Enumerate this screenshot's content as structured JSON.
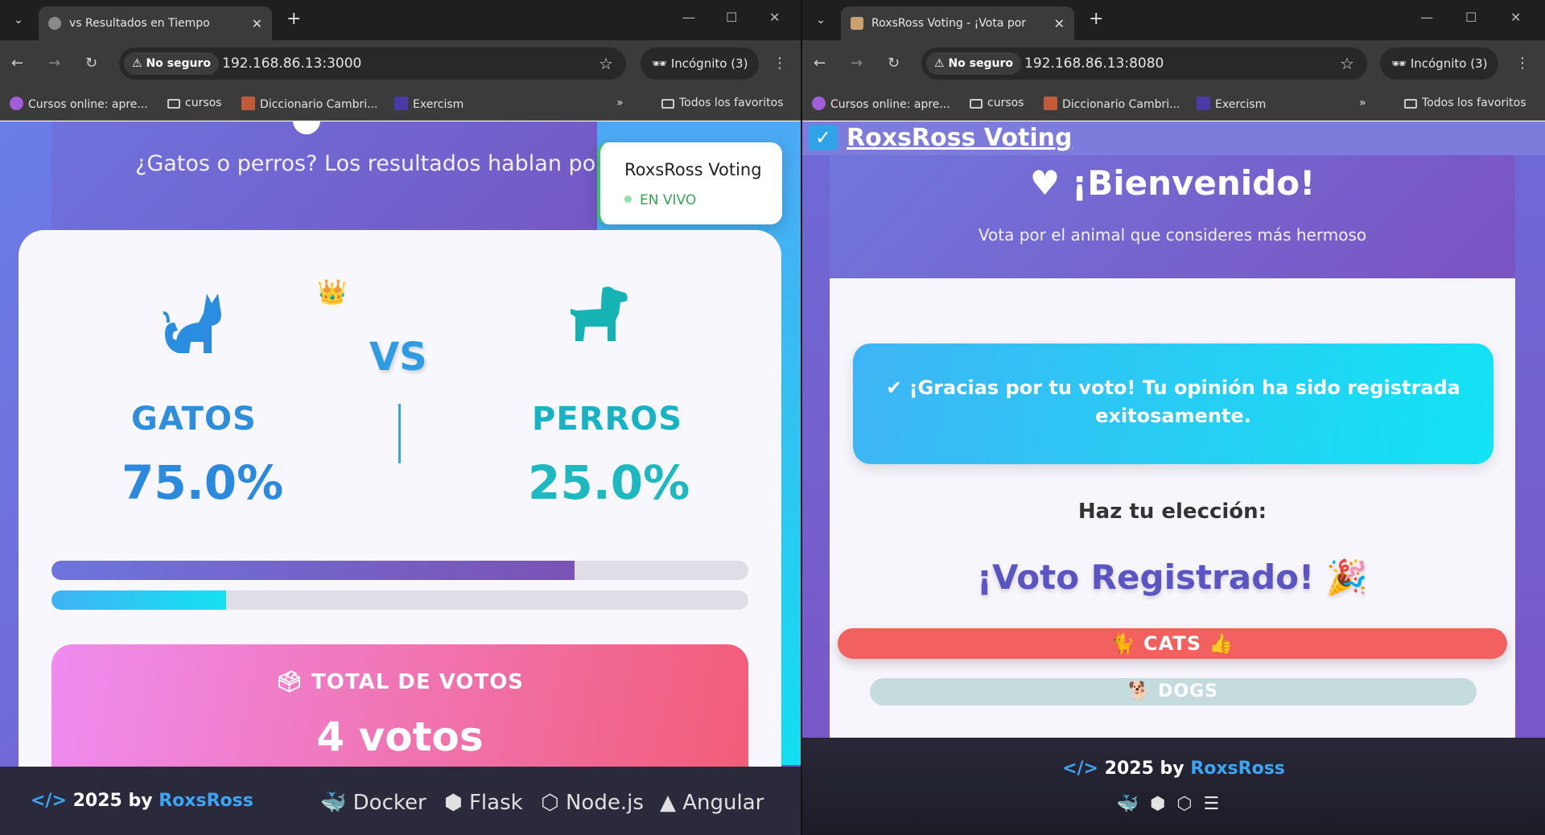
{
  "left": {
    "tab_title": "vs  Resultados en Tiempo",
    "tab_emoji": "🐱 vs 🐶",
    "url": "192.168.86.13:3000",
    "not_secure": "No seguro",
    "incognito": "Incógnito (3)",
    "bookmarks": [
      "Cursos online: apre...",
      "cursos",
      "Diccionario Cambri...",
      "Exercism"
    ],
    "all_bookmarks": "Todos los favoritos",
    "subtitle": "¿Gatos o perros? Los resultados hablan por s",
    "live_title": "RoxsRoss Voting",
    "live_status": "EN VIVO",
    "vs": "VS",
    "cats_label": "GATOS",
    "dogs_label": "PERROS",
    "cats_pct": "75.0%",
    "dogs_pct": "25.0%",
    "cats_share": 0.75,
    "dogs_share": 0.25,
    "total_label": "TOTAL DE VOTOS",
    "total_value": "4 votos",
    "footer_year": "2025 by",
    "footer_brand": "RoxsRoss",
    "tech": [
      "Docker",
      "Flask",
      "Node.js",
      "Angular"
    ]
  },
  "right": {
    "tab_title": "RoxsRoss Voting - ¡Vota por",
    "url": "192.168.86.13:8080",
    "not_secure": "No seguro",
    "incognito": "Incógnito (3)",
    "bookmarks": [
      "Cursos online: apre...",
      "cursos",
      "Diccionario Cambri...",
      "Exercism"
    ],
    "all_bookmarks": "Todos los favoritos",
    "app_title": "RoxsRoss Voting",
    "welcome_title": "¡Bienvenido!",
    "welcome_sub": "Vota por el animal que consideres más hermoso",
    "thanks": "¡Gracias por tu voto! Tu opinión ha sido registrada exitosamente.",
    "choose": "Haz tu elección:",
    "registered": "¡Voto Registrado!",
    "cats_btn": "CATS",
    "dogs_btn": "DOGS",
    "footer_year": "2025 by",
    "footer_brand": "RoxsRoss"
  },
  "colors": {
    "cats_bar": "#6d6ad8",
    "dogs_bar": "#18dcf0",
    "accent": "#3aa7f5"
  }
}
